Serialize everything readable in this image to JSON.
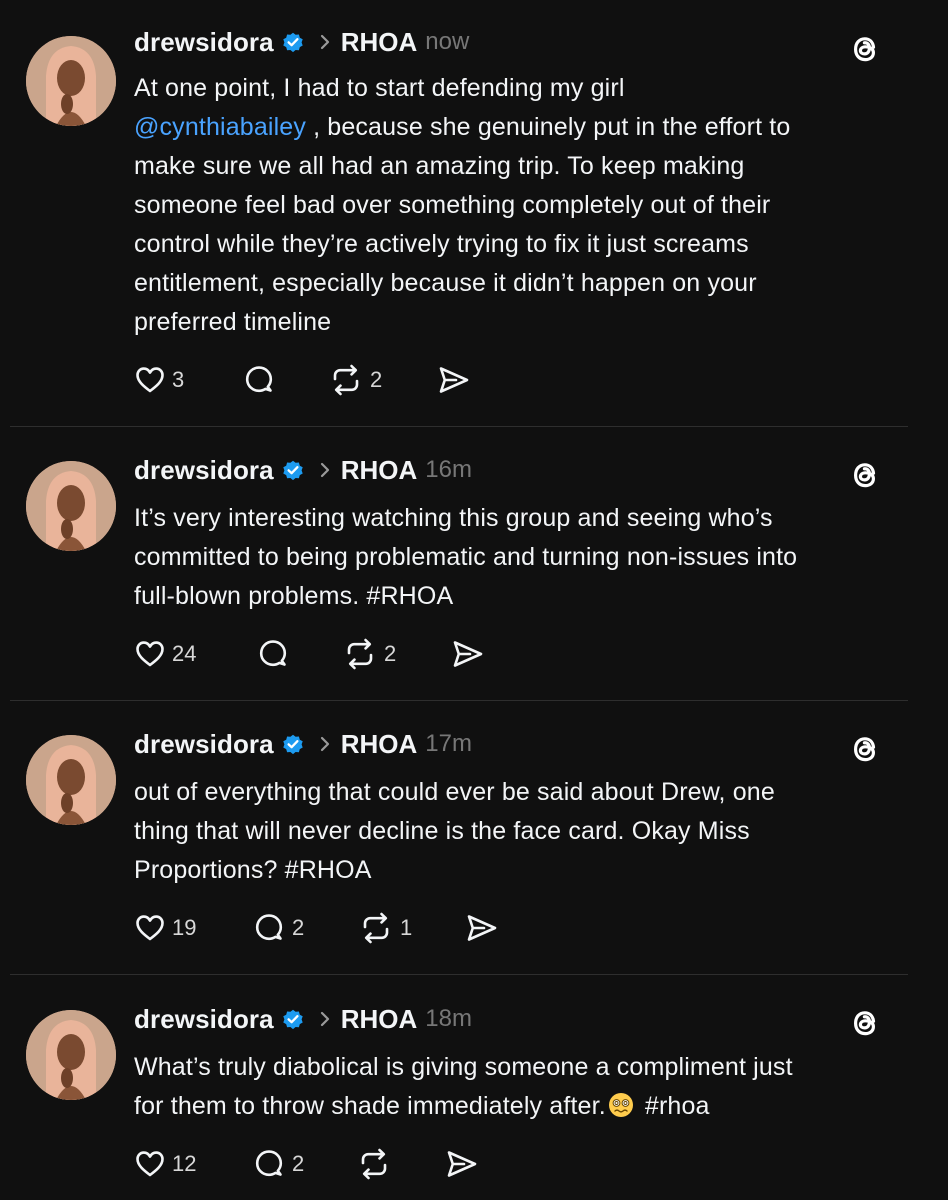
{
  "feed": {
    "posts": [
      {
        "username": "drewsidora",
        "community": "RHOA",
        "time": "now",
        "lines": [
          "At one point, I had to start defending my girl",
          "",
          "make sure we all had an amazing trip. To keep making",
          "someone feel bad over something completely out of their",
          "control while they’re actively trying to fix it just screams",
          "entitlement, especially because it didn’t happen on your",
          "preferred timeline"
        ],
        "mention": "@cynthiabailey",
        "mention_rest": " , because she genuinely put in the effort to",
        "likes": "3",
        "replies": "",
        "reposts": "2"
      },
      {
        "username": "drewsidora",
        "community": "RHOA",
        "time": "16m",
        "lines": [
          "It’s very interesting watching this group and seeing who’s",
          "committed to being problematic and turning non-issues into",
          "full-blown problems. #RHOA"
        ],
        "likes": "24",
        "replies": "",
        "reposts": "2"
      },
      {
        "username": "drewsidora",
        "community": "RHOA",
        "time": "17m",
        "lines": [
          "out of everything that could ever be said about Drew, one",
          "thing that will never decline is the face card. Okay Miss",
          "Proportions? #RHOA"
        ],
        "likes": "19",
        "replies": "2",
        "reposts": "1"
      },
      {
        "username": "drewsidora",
        "community": "RHOA",
        "time": "18m",
        "lines": [
          "What’s truly diabolical is giving someone a compliment just",
          "for them to throw shade immediately after."
        ],
        "line2_tail": "#rhoa",
        "emoji": "woozy-face",
        "likes": "12",
        "replies": "2",
        "reposts": ""
      }
    ]
  },
  "colors": {
    "background": "#101010",
    "text": "#f3f5f7",
    "muted": "#777777",
    "mention": "#4aa3ff",
    "verified": "#1d9bf0",
    "divider": "#2e2e2e"
  },
  "icons": [
    "verified-badge-icon",
    "chevron-right-icon",
    "threads-logo-icon",
    "heart-icon",
    "reply-icon",
    "repost-icon",
    "share-icon"
  ]
}
